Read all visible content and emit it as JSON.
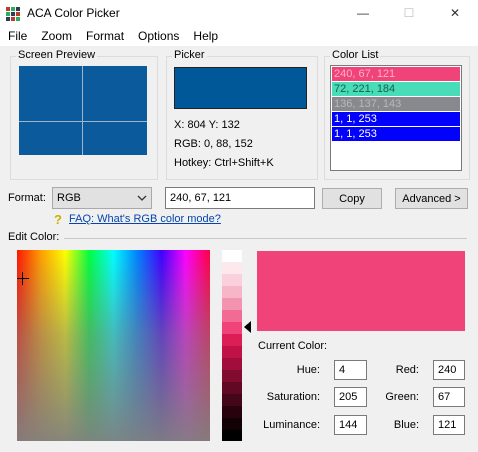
{
  "window": {
    "title": "ACA Color Picker",
    "minimize_glyph": "—",
    "maximize_glyph": "☐",
    "close_glyph": "✕"
  },
  "menu": [
    "File",
    "Zoom",
    "Format",
    "Options",
    "Help"
  ],
  "screen_preview": {
    "label": "Screen Preview",
    "color": "#0b5a9c"
  },
  "picker": {
    "label": "Picker",
    "color": "#005898",
    "position": "X: 804 Y: 132",
    "rgb": "RGB: 0, 88, 152",
    "hotkey": "Hotkey: Ctrl+Shift+K"
  },
  "color_list": {
    "label": "Color List",
    "items": [
      {
        "text": "240, 67, 121",
        "bg": "#f04379",
        "fg": "#ffb0c8"
      },
      {
        "text": "72, 221, 184",
        "bg": "#48ddb8",
        "fg": "#1b5c4c"
      },
      {
        "text": "136, 137, 143",
        "bg": "#88898f",
        "fg": "#b8b8b8"
      },
      {
        "text": "1, 1, 253",
        "bg": "#0101fd",
        "fg": "#ffffff"
      },
      {
        "text": "1, 1, 253",
        "bg": "#0101fd",
        "fg": "#ffffff"
      }
    ]
  },
  "format": {
    "label": "Format:",
    "selected": "RGB",
    "value": "240, 67, 121",
    "copy_label": "Copy",
    "advanced_label": "Advanced >",
    "faq_link": "FAQ: What's RGB color mode?"
  },
  "edit_color": {
    "label": "Edit Color:",
    "current_label": "Current Color:",
    "current_color": "#f04379",
    "hue_label": "Hue:",
    "hue": "4",
    "saturation_label": "Saturation:",
    "saturation": "205",
    "luminance_label": "Luminance:",
    "luminance": "144",
    "red_label": "Red:",
    "red": "240",
    "green_label": "Green:",
    "green": "67",
    "blue_label": "Blue:",
    "blue": "121"
  }
}
